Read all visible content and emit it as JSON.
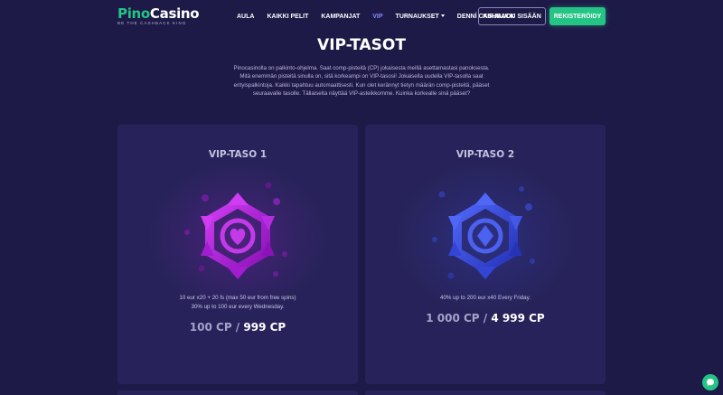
{
  "logo": {
    "part1": "Pino",
    "part2": "Casino",
    "tagline": "BE THE CASHBACK KING"
  },
  "nav": [
    {
      "label": "AULA",
      "active": false
    },
    {
      "label": "KAIKKI PELIT",
      "active": false
    },
    {
      "label": "KAMPANJAT",
      "active": false
    },
    {
      "label": "VIP",
      "active": true
    },
    {
      "label": "TURNAUKSET",
      "active": false,
      "dropdown": true
    },
    {
      "label": "DENNÍ CASHBACK",
      "active": false
    }
  ],
  "auth": {
    "login_label": "KIRJAUDU SISÄÄN",
    "register_label": "REKISTERÖIDY"
  },
  "page": {
    "title": "VIP-TASOT",
    "intro_lines": [
      "Pinocasinolla on palkinto-ohjelma. Saat comp-pisteitä (CP) jokaisesta meillä asettamastasi panoksesta.",
      "Mitä enemmän pisteitä sinulla on, sitä korkeampi on VIP-tasosi! Jokaisella uudella VIP-tasolla saat",
      "erityispalkintoja. Kaikki tapahtuu automaattisesti. Kun olet kerännyt tietyn määrän comp-pisteitä, pääset",
      "seuraavalle tasolle. Tällaiselta näyttää VIP-asteikkomme. Kuinka korkealle sinä pääset?"
    ]
  },
  "levels": [
    {
      "title": "VIP-TASO 1",
      "color": "#b21fdb",
      "icon": "heart-suit-icon",
      "desc_lines": [
        "10 eur x20 + 20 fs (max 50 eur from free spins)",
        "30% up to 100 eur every Wednesday."
      ],
      "cp_min": "100 CP",
      "separator": "/",
      "cp_max": "999 CP"
    },
    {
      "title": "VIP-TASO 2",
      "color": "#3d4fe0",
      "icon": "diamond-suit-icon",
      "desc_lines": [
        "40% up to 200 eur x40 Every Friday."
      ],
      "cp_min": "1 000 CP",
      "separator": "/",
      "cp_max": "4 999 CP"
    }
  ],
  "colors": {
    "background": "#1e1a47",
    "card": "#27235a",
    "accent_green": "#24c485",
    "nav_active": "#7f8cff"
  },
  "chat": {
    "icon": "chat-bubble-icon"
  }
}
